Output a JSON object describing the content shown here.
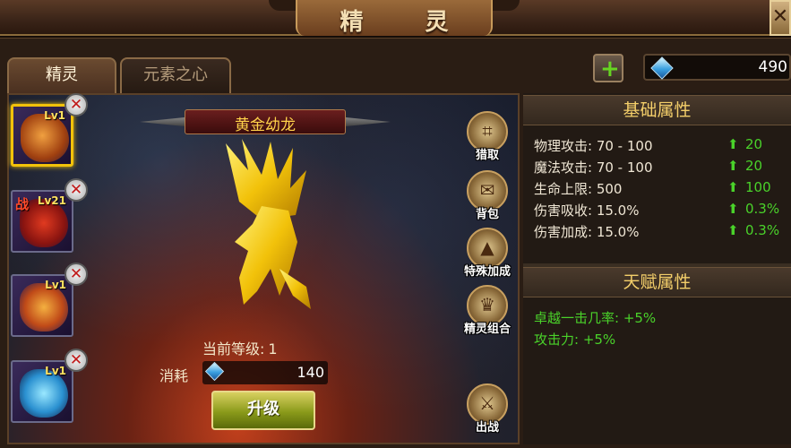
{
  "window": {
    "title": "精 灵",
    "close_label": "✕"
  },
  "tabs": [
    {
      "label": "精灵",
      "active": true
    },
    {
      "label": "元素之心",
      "active": false
    }
  ],
  "currency": {
    "add_label": "+",
    "amount": "490",
    "icon": "blue-gem-icon"
  },
  "slots": [
    {
      "level": "Lv1",
      "battle": "",
      "selected": true,
      "color": "#e07a2a",
      "icon": "fire-dragon-icon"
    },
    {
      "level": "Lv21",
      "battle": "战",
      "selected": false,
      "color": "#c0281a",
      "icon": "red-beast-icon"
    },
    {
      "level": "Lv1",
      "battle": "",
      "selected": false,
      "color": "#e0902a",
      "icon": "phoenix-icon"
    },
    {
      "level": "Lv1",
      "battle": "",
      "selected": false,
      "color": "#3ac0e8",
      "icon": "ice-dragon-icon"
    }
  ],
  "pet": {
    "name": "黄金幼龙",
    "level_label": "当前等级:",
    "level_value": "1"
  },
  "cost": {
    "label": "消耗",
    "amount": "140"
  },
  "upgrade_label": "升级",
  "side_buttons": [
    {
      "label": "猎取",
      "icon": "net-icon",
      "sym": "⌗"
    },
    {
      "label": "背包",
      "icon": "bag-icon",
      "sym": "✉"
    },
    {
      "label": "特殊加成",
      "icon": "arrow-up-icon",
      "sym": "▲"
    },
    {
      "label": "精灵组合",
      "icon": "helmet-icon",
      "sym": "♛"
    },
    {
      "label": "出战",
      "icon": "crossed-swords-icon",
      "sym": "⚔"
    }
  ],
  "base_attributes": {
    "title": "基础属性",
    "rows": [
      {
        "label": "物理攻击: 70 - 100",
        "bonus": "20"
      },
      {
        "label": "魔法攻击: 70 - 100",
        "bonus": "20"
      },
      {
        "label": "生命上限: 500",
        "bonus": "100"
      },
      {
        "label": "伤害吸收: 15.0%",
        "bonus": "0.3%"
      },
      {
        "label": "伤害加成: 15.0%",
        "bonus": "0.3%"
      }
    ]
  },
  "talent_attributes": {
    "title": "天赋属性",
    "rows": [
      {
        "label": "卓越一击几率: +5%"
      },
      {
        "label": "攻击力: +5%"
      }
    ]
  },
  "colors": {
    "accent_gold": "#f4cf6a",
    "bonus_green": "#4ad22a",
    "selected_border": "#f2c20a"
  }
}
